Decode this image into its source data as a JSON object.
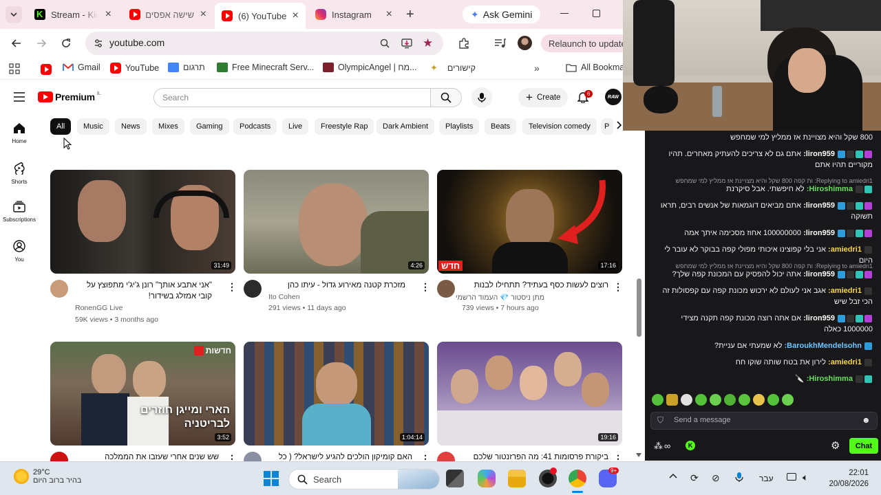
{
  "browser": {
    "tabs": [
      {
        "label": "Stream - Kick",
        "icon": "kick-icon"
      },
      {
        "label": "שישה אפסים",
        "icon": "youtube-icon"
      },
      {
        "label": "(6) YouTube",
        "icon": "youtube-icon"
      },
      {
        "label": "Instagram",
        "icon": "instagram-icon"
      }
    ],
    "gemini_label": "Ask Gemini",
    "url": "youtube.com",
    "relaunch_label": "Relaunch to update",
    "bookmarks": [
      {
        "label": "Gmail"
      },
      {
        "label": "YouTube"
      },
      {
        "label": "תרגום"
      },
      {
        "label": "Free Minecraft Serv..."
      },
      {
        "label": "OlympicAngel | מח..."
      },
      {
        "label": "קישורים"
      },
      {
        "label": "All Bookma"
      }
    ]
  },
  "youtube": {
    "logo_text": "Premium",
    "logo_region": "IL",
    "search_placeholder": "Search",
    "create_label": "Create",
    "notifications_count": "6",
    "chips": [
      "All",
      "Music",
      "News",
      "Mixes",
      "Gaming",
      "Podcasts",
      "Live",
      "Freestyle Rap",
      "Dark Ambient",
      "Playlists",
      "Beats",
      "Television comedy",
      "P"
    ],
    "sidebar": [
      {
        "label": "Home",
        "icon": "home-icon"
      },
      {
        "label": "Shorts",
        "icon": "shorts-icon"
      },
      {
        "label": "Subscriptions",
        "icon": "subscriptions-icon"
      },
      {
        "label": "You",
        "icon": "you-icon"
      }
    ],
    "videos": [
      {
        "title": "\"אני אתבע אותך\" רונן ג'יג'י מתפוצץ על קובי אמזלג בשידור!",
        "channel": "RonenGG Live",
        "meta": "59K views • 3 months ago",
        "duration": "31:49"
      },
      {
        "title": "מזכרת קטנה מאירוע גדול - עיתו כהן",
        "channel": "Ito Cohen",
        "meta": "291 views • 11 days ago",
        "duration": "4:26"
      },
      {
        "title": "רוצים לעשות כסף בעתיד? תתחילו לבנות מותג",
        "channel": "מתן ניסטור 💎 העמוד הרשמי",
        "meta": "739 views • 7 hours ago",
        "duration": "17:16",
        "badge": "חדש"
      },
      {
        "title": "שש שנים אחרי שעזבו את הממלכה הבריטית -",
        "channel": "",
        "meta": "",
        "duration": "3:52",
        "overlay": "הארי ומייגן חוזרים לבריטניה",
        "corner": "חדשות"
      },
      {
        "title": "האם קומיקון הולכים להגיע לישראל? ( כל",
        "channel": "",
        "meta": "",
        "duration": "1:04:14"
      },
      {
        "title": "ביקורת פרסומות 41: מה הפרזנטור שלכם",
        "channel": "",
        "meta": "",
        "duration": "19:16"
      }
    ]
  },
  "chat": {
    "messages": [
      {
        "type": "text",
        "user": "",
        "text": "800 שקל והיא מצויינת אז ממליץ למי שמחפש"
      },
      {
        "type": "text",
        "user": "liron959:",
        "text": "אתם גם לא צריכים להעתיק מאחרים. תהיו מקוריים תהיו אתם"
      },
      {
        "type": "sys",
        "user": "",
        "text": "Replying to amiedri1: ות קפה 800 שקל והיא מצויינת אז ממליץ למי שמחפש"
      },
      {
        "type": "text",
        "user": "Hiroshimma:",
        "text": "לא חיפשתי. אבל סיקרנת"
      },
      {
        "type": "text",
        "user": "liron959:",
        "text": "אתם מביאים דוגמאות של אנשים רבים, תראו תשוקה"
      },
      {
        "type": "text",
        "user": "liron959:",
        "text": "100000000 אחוז מסכימה איתך אמה"
      },
      {
        "type": "text",
        "user": "amiedri1:",
        "text": "אני בלי קפוצינו איכותי מפולי קפה בבוקר לא עובר לי היום"
      },
      {
        "type": "sys",
        "user": "",
        "text": "Replying to amiedri1: ות קפה 800 שקל והיא מצויינת אז ממליץ למי שמחפש"
      },
      {
        "type": "text",
        "user": "liron959:",
        "text": "אתה יכול להפסיק עם המכונת קפה שלך?"
      },
      {
        "type": "text",
        "user": "amiedri1:",
        "text": "אגב אני לעולם לא ירכוש מכונת קפה עם קפסולות זה הכי זבל שיש"
      },
      {
        "type": "text",
        "user": "liron959:",
        "text": "אם אתה רוצה מכונת קפה תקנה מצידי 1000000 כאלה"
      },
      {
        "type": "text",
        "user": "BaroukhMendelsohn:",
        "text": "לא שמעתי אם עניית?"
      },
      {
        "type": "text",
        "user": "amiedri1:",
        "text": "לירון את בטח שותה שוקו חח"
      },
      {
        "type": "text",
        "user": "Hiroshimma:",
        "text": "🔪"
      }
    ],
    "input_placeholder": "Send a message",
    "send_label": "Chat"
  },
  "taskbar": {
    "temperature": "29°C",
    "weather": "בהיר ברוב היום",
    "search_label": "Search",
    "language": "עבר",
    "time": "22:01",
    "date": "20/08/2026",
    "discord_badge": "9+"
  }
}
